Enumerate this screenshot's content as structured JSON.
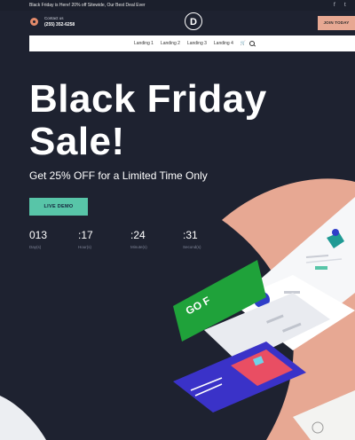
{
  "topbar": {
    "announcement": "Black Friday is Here! 20% off Sitewide, Our Best Deal Ever",
    "social": [
      "f",
      "t"
    ]
  },
  "header": {
    "contact_label": "Contact us",
    "phone": "(255) 352-6258",
    "logo_letter": "D",
    "join_label": "JOIN TODAY"
  },
  "nav": {
    "items": [
      "Landing 1",
      "Landing 2",
      "Landing 3",
      "Landing 4"
    ],
    "cart_icon": "cart-icon",
    "search_icon": "search-icon"
  },
  "hero": {
    "title_line1": "Black Friday",
    "title_line2": "Sale!",
    "subheading": "Get 25% OFF for a Limited Time Only",
    "button_label": "LIVE DEMO"
  },
  "countdown": [
    {
      "value": "013",
      "label": "Day(s)"
    },
    {
      "value": ":17",
      "label": "Hour(s)"
    },
    {
      "value": ":24",
      "label": "Minute(s)"
    },
    {
      "value": ":31",
      "label": "Second(s)"
    }
  ],
  "colors": {
    "background": "#1e2230",
    "accent_peach": "#e7a893",
    "accent_teal": "#58c5a8",
    "card_green": "#1fa23a",
    "card_blue": "#2f3ec9"
  }
}
